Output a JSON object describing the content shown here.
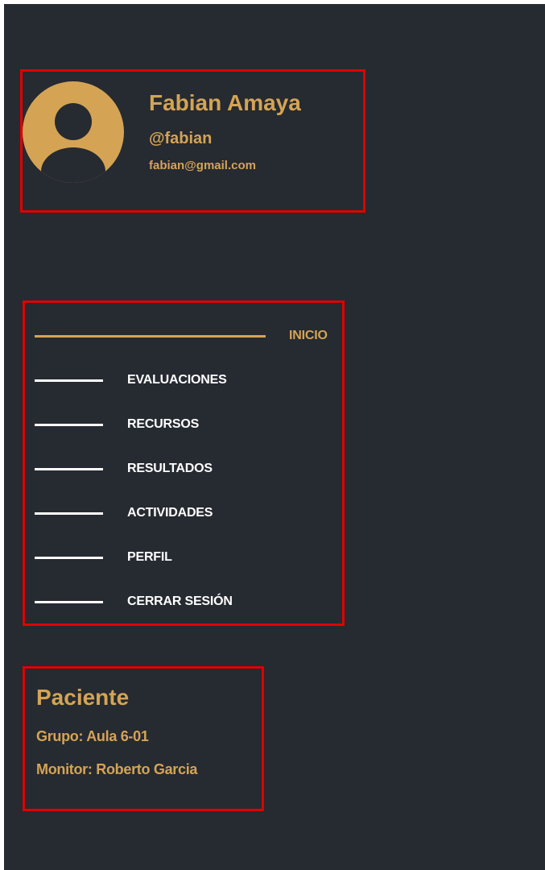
{
  "profile": {
    "name": "Fabian Amaya",
    "handle": "@fabian",
    "email": "fabian@gmail.com",
    "avatar_icon": "user-circle-icon"
  },
  "nav": {
    "items": [
      {
        "label": "INICIO",
        "active": true
      },
      {
        "label": "EVALUACIONES",
        "active": false
      },
      {
        "label": "RECURSOS",
        "active": false
      },
      {
        "label": "RESULTADOS",
        "active": false
      },
      {
        "label": "ACTIVIDADES",
        "active": false
      },
      {
        "label": "PERFIL",
        "active": false
      },
      {
        "label": "CERRAR SESIÓN",
        "active": false
      }
    ]
  },
  "patient": {
    "role": "Paciente",
    "group": "Grupo: Aula 6-01",
    "monitor": "Monitor: Roberto Garcia"
  },
  "colors": {
    "background": "#262a31",
    "accent": "#d4a454",
    "text": "#ffffff",
    "highlight_border": "#e00000"
  }
}
